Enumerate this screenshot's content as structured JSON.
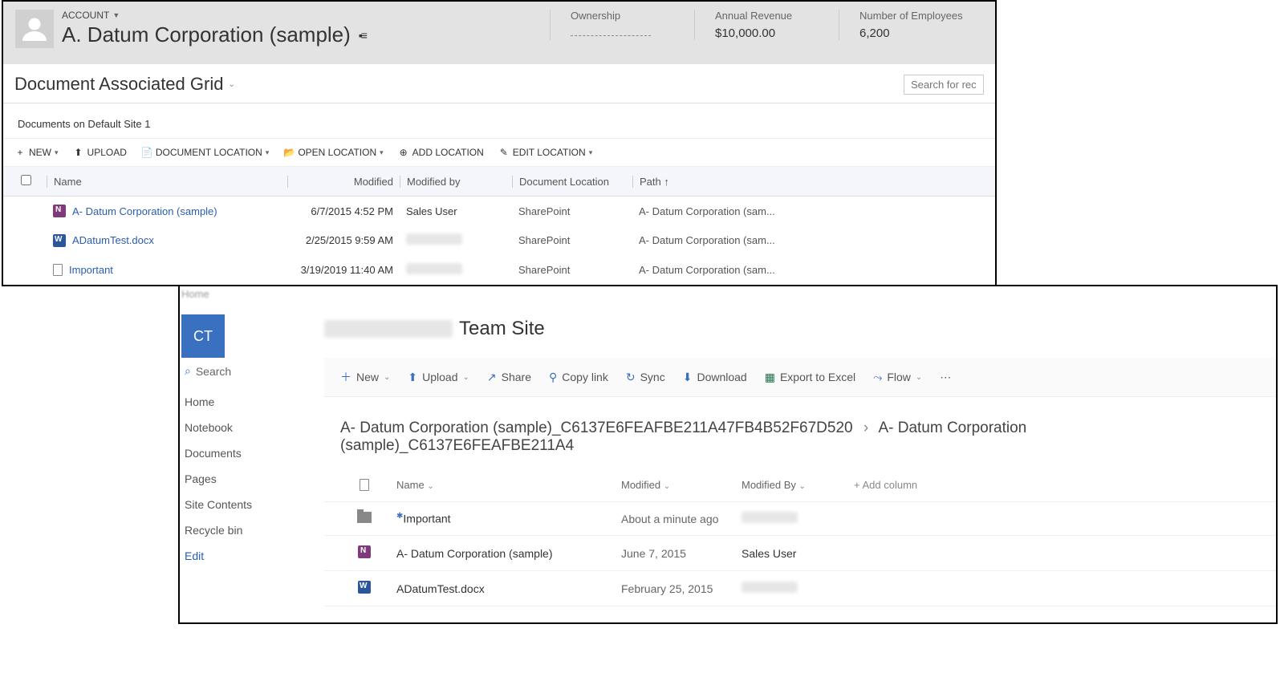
{
  "crm": {
    "entity_label": "ACCOUNT",
    "account_name": "A. Datum Corporation (sample)",
    "summary": [
      {
        "label": "Ownership",
        "value": ""
      },
      {
        "label": "Annual Revenue",
        "value": "$10,000.00"
      },
      {
        "label": "Number of Employees",
        "value": "6,200"
      }
    ],
    "grid_title": "Document Associated Grid",
    "location_breadcrumb": "Documents on Default Site 1",
    "search_placeholder": "Search for reco",
    "toolbar": {
      "new": "NEW",
      "upload": "UPLOAD",
      "doc_location": "DOCUMENT LOCATION",
      "open_location": "OPEN LOCATION",
      "add_location": "ADD LOCATION",
      "edit_location": "EDIT LOCATION"
    },
    "columns": {
      "name": "Name",
      "modified": "Modified",
      "modified_by": "Modified by",
      "location": "Document Location",
      "path": "Path ↑"
    },
    "rows": [
      {
        "icon": "onenote",
        "name": "A- Datum Corporation (sample)",
        "modified": "6/7/2015 4:52 PM",
        "modified_by": "Sales User",
        "location": "SharePoint",
        "path": "A- Datum Corporation (sam..."
      },
      {
        "icon": "word",
        "name": "ADatumTest.docx",
        "modified": "2/25/2015 9:59 AM",
        "modified_by": "",
        "location": "SharePoint",
        "path": "A- Datum Corporation (sam..."
      },
      {
        "icon": "blank",
        "name": "Important",
        "modified": "3/19/2019 11:40 AM",
        "modified_by": "",
        "location": "SharePoint",
        "path": "A- Datum Corporation (sam..."
      }
    ]
  },
  "sp": {
    "logo_initials": "CT",
    "site_prefix_blurred": "CRMC3Online",
    "site_name": "Team Site",
    "search": "Search",
    "nav": [
      "Home",
      "Notebook",
      "Documents",
      "Pages",
      "Site Contents",
      "Recycle bin"
    ],
    "nav_edit": "Edit",
    "toolbar": {
      "new": "New",
      "upload": "Upload",
      "share": "Share",
      "copy_link": "Copy link",
      "sync": "Sync",
      "download": "Download",
      "export": "Export to Excel",
      "flow": "Flow"
    },
    "breadcrumb": {
      "seg1": "A- Datum Corporation (sample)_C6137E6FEAFBE211A47FB4B52F67D520",
      "seg2": "A- Datum Corporation (sample)_C6137E6FEAFBE211A4"
    },
    "columns": {
      "name": "Name",
      "modified": "Modified",
      "modified_by": "Modified By",
      "add": "Add column"
    },
    "rows": [
      {
        "icon": "folder",
        "name": "Important",
        "modified": "About a minute ago",
        "modified_by": "",
        "new_marker": true
      },
      {
        "icon": "onenote",
        "name": "A- Datum Corporation (sample)",
        "modified": "June 7, 2015",
        "modified_by": "Sales User"
      },
      {
        "icon": "word",
        "name": "ADatumTest.docx",
        "modified": "February 25, 2015",
        "modified_by": ""
      }
    ]
  }
}
